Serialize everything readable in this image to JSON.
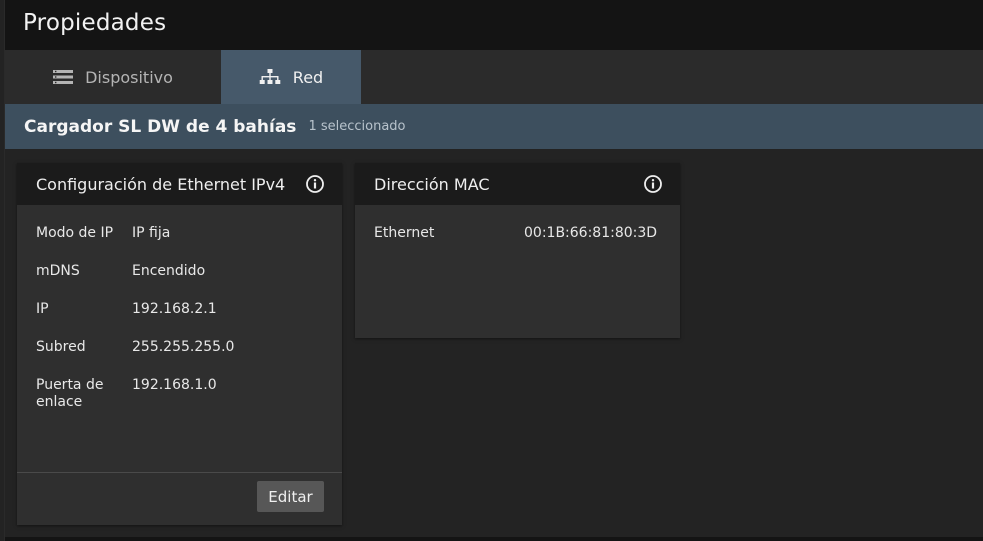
{
  "window": {
    "title": "Propiedades"
  },
  "tabs": [
    {
      "label": "Dispositivo",
      "icon": "list-icon",
      "active": false
    },
    {
      "label": "Red",
      "icon": "network-icon",
      "active": true
    }
  ],
  "selection": {
    "device_name": "Cargador SL DW de 4 bahías",
    "count_text": "1 seleccionado"
  },
  "ipv4_panel": {
    "title": "Configuración de Ethernet IPv4",
    "rows": [
      {
        "label": "Modo de IP",
        "value": "IP fija"
      },
      {
        "label": "mDNS",
        "value": "Encendido"
      },
      {
        "label": "IP",
        "value": "192.168.2.1"
      },
      {
        "label": "Subred",
        "value": "255.255.255.0"
      },
      {
        "label": "Puerta de enlace",
        "value": "192.168.1.0"
      }
    ],
    "edit_label": "Editar"
  },
  "mac_panel": {
    "title": "Dirección MAC",
    "rows": [
      {
        "label": "Ethernet",
        "value": "00:1B:66:81:80:3D"
      }
    ]
  },
  "colors": {
    "active_tab": "#46596a",
    "selection_bar": "#3d4f5e",
    "title_bar": "#141414",
    "panel_header": "#1b1b1b",
    "panel_body": "#2f2f2f"
  }
}
